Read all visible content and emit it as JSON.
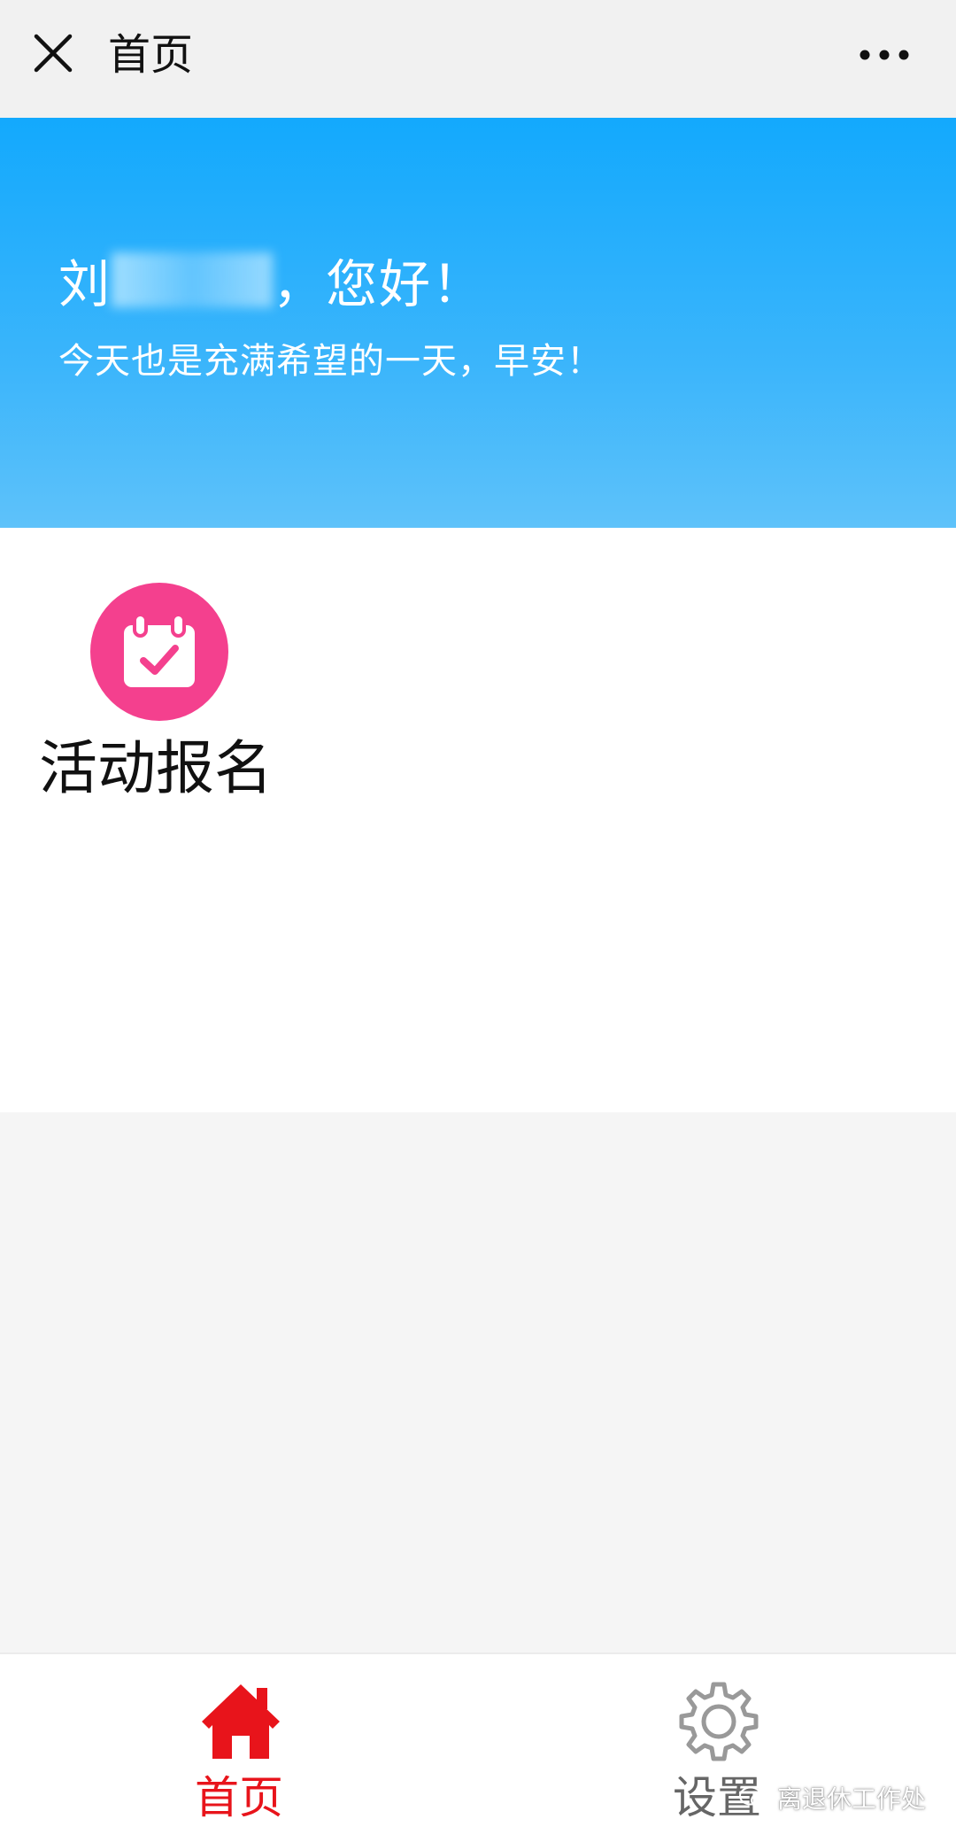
{
  "nav": {
    "title": "首页",
    "close_icon": "close-icon",
    "more_icon": "more-dots-icon"
  },
  "banner": {
    "greeting_prefix": "刘",
    "greeting_suffix": "，您好！",
    "subtitle": "今天也是充满希望的一天，早安！",
    "color": "#13a9fd"
  },
  "apps": [
    {
      "label": "活动报名",
      "icon": "calendar-check-icon",
      "color": "#f4408e"
    }
  ],
  "tabbar": {
    "items": [
      {
        "label": "首页",
        "icon": "home-icon",
        "active": true,
        "color": "#e8141b"
      },
      {
        "label": "设置",
        "icon": "gear-icon",
        "active": false,
        "color": "#999999"
      }
    ]
  },
  "watermark": {
    "text": "离退休工作处",
    "icon": "wechat-icon"
  }
}
